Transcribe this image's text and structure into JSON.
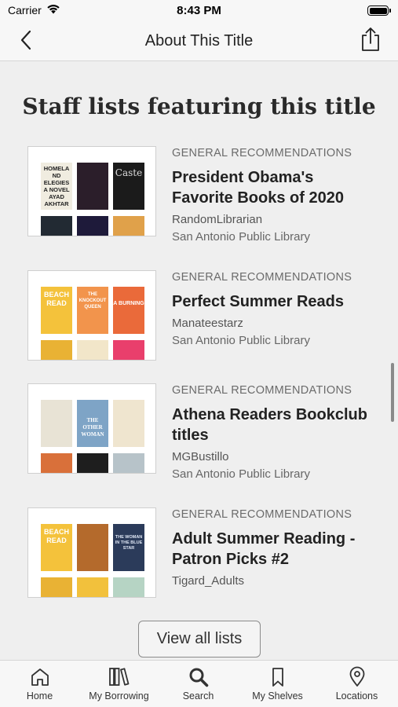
{
  "status_bar": {
    "carrier": "Carrier",
    "time": "8:43 PM"
  },
  "nav": {
    "title": "About This Title",
    "back_icon": "chevron-left-icon",
    "share_icon": "share-icon"
  },
  "section": {
    "heading": "Staff lists featuring this title"
  },
  "lists": [
    {
      "category": "GENERAL RECOMMENDATIONS",
      "title_line1": "President Obama's",
      "title_line2": "Favorite Books of 2020",
      "creator": "RandomLibrarian",
      "library": "San Antonio Public Library",
      "cover_text": [
        "HOMELAND ELEGIES A NOVEL AYAD AKHTAR",
        "",
        "Caste"
      ],
      "cover_colors": [
        "#f0ece0",
        "#2b1e2a",
        "#1b1b1b",
        "#222a33",
        "#1e1a3a",
        "#e0a14a"
      ]
    },
    {
      "category": "GENERAL RECOMMENDATIONS",
      "title_line1": "Perfect Summer Reads",
      "title_line2": "",
      "creator": "Manateestarz",
      "library": "San Antonio Public Library",
      "cover_text": [
        "BEACH READ",
        "THE KNOCKOUT QUEEN",
        "A BURNING"
      ],
      "cover_colors": [
        "#f4c23b",
        "#f2944c",
        "#ea6a3a",
        "#e9b234",
        "#f2e6c9",
        "#e93f6c"
      ]
    },
    {
      "category": "GENERAL RECOMMENDATIONS",
      "title_line1": "Athena Readers Bookclub",
      "title_line2": "titles",
      "creator": "MGBustillo",
      "library": "San Antonio Public Library",
      "cover_text": [
        "",
        "THE OTHER WOMAN",
        ""
      ],
      "cover_colors": [
        "#e8e3d5",
        "#7ea4c6",
        "#efe5cf",
        "#d9703a",
        "#1e1e1e",
        "#b7c3c9"
      ]
    },
    {
      "category": "GENERAL RECOMMENDATIONS",
      "title_line1": "Adult Summer Reading -",
      "title_line2": "Patron Picks #2",
      "creator": "Tigard_Adults",
      "library": "",
      "cover_text": [
        "BEACH READ",
        "",
        "THE WOMAN IN THE BLUE STAR"
      ],
      "cover_colors": [
        "#f4c23b",
        "#b46a2c",
        "#2b3b5a",
        "#e9b234",
        "#f2c13c",
        "#b6d4c4"
      ]
    }
  ],
  "view_all": {
    "label": "View all lists"
  },
  "tabs": [
    {
      "label": "Home",
      "icon": "home-icon"
    },
    {
      "label": "My Borrowing",
      "icon": "books-icon"
    },
    {
      "label": "Search",
      "icon": "search-icon"
    },
    {
      "label": "My Shelves",
      "icon": "bookmark-icon"
    },
    {
      "label": "Locations",
      "icon": "location-pin-icon"
    }
  ]
}
